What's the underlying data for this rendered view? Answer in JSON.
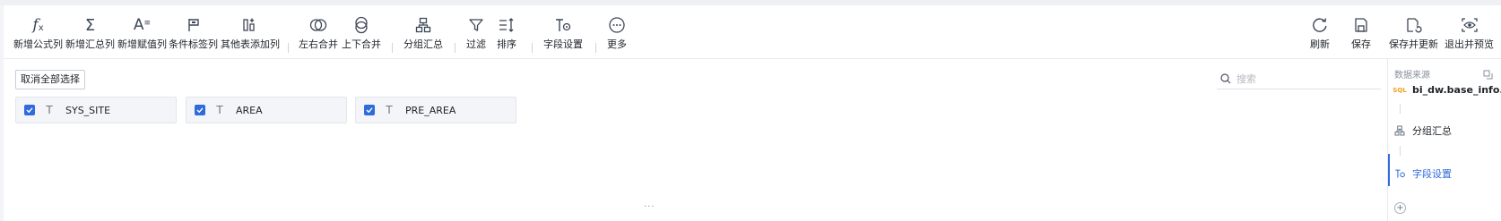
{
  "toolbar": {
    "formula": "新增公式列",
    "summary": "新增汇总列",
    "assign": "新增赋值列",
    "condition": "条件标签列",
    "other_table": "其他表添加列",
    "lr_merge": "左右合并",
    "ud_merge": "上下合并",
    "group_summary": "分组汇总",
    "filter": "过滤",
    "sort": "排序",
    "field_settings": "字段设置",
    "more": "更多",
    "refresh": "刷新",
    "save": "保存",
    "save_update": "保存并更新",
    "exit_preview": "退出并预览"
  },
  "content": {
    "cancel_all": "取消全部选择",
    "search_placeholder": "搜索",
    "fields": [
      {
        "name": "SYS_SITE",
        "type_icon": "T",
        "checked": true
      },
      {
        "name": "AREA",
        "type_icon": "T",
        "checked": true
      },
      {
        "name": "PRE_AREA",
        "type_icon": "T",
        "checked": true
      }
    ],
    "resize_handle": "···"
  },
  "panel": {
    "title": "数据来源",
    "source_tag": "SQL",
    "source": "bi_dw.base_info...",
    "steps": [
      {
        "label": "分组汇总",
        "icon": "group-summary-icon"
      },
      {
        "label": "字段设置",
        "icon": "field-settings-icon",
        "active": true
      }
    ],
    "add": "+"
  },
  "colors": {
    "accent": "#2f6bdb",
    "sql_tag": "#f0a020",
    "icon": "#3d4757"
  }
}
